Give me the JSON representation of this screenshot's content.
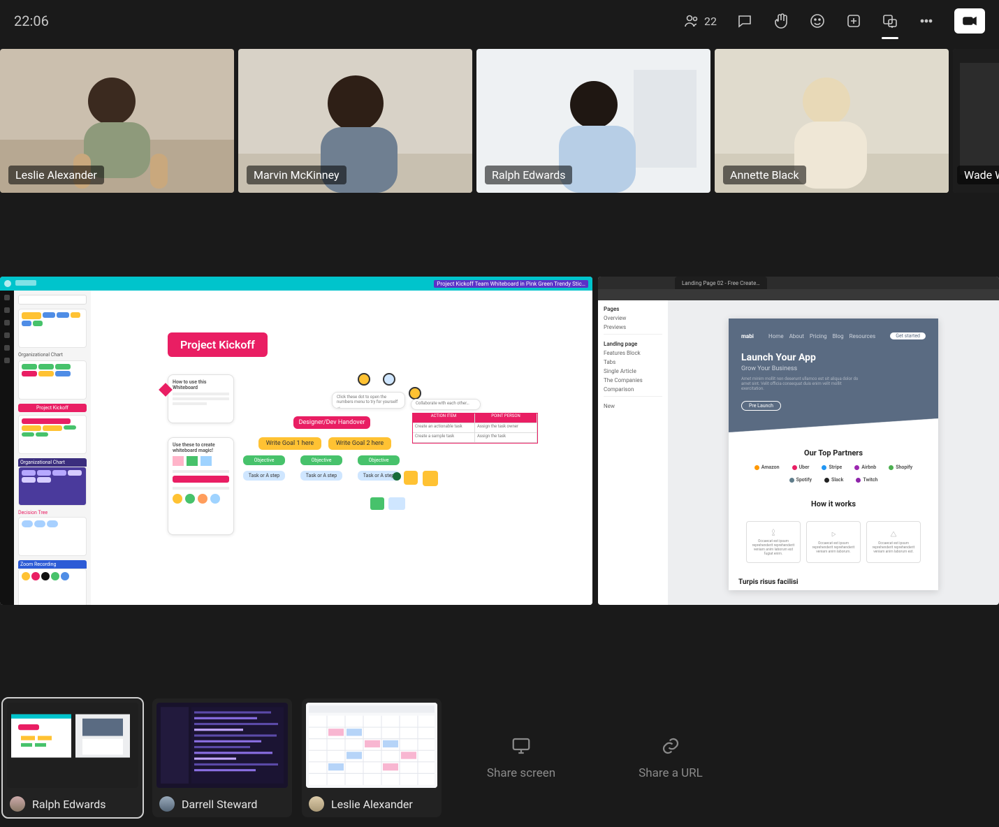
{
  "timer": "22:06",
  "top": {
    "participants_count": "22",
    "icons": {
      "people": "people-icon",
      "chat": "chat-icon",
      "hand": "raise-hand-icon",
      "emoji": "emoji-icon",
      "add": "add-app-icon",
      "layout": "view-layout-icon",
      "more": "more-icon",
      "camera": "camera-icon"
    }
  },
  "participants": [
    {
      "name": "Leslie Alexander"
    },
    {
      "name": "Marvin McKinney"
    },
    {
      "name": "Ralph Edwards"
    },
    {
      "name": "Annette Black"
    },
    {
      "name": "Wade Warren"
    }
  ],
  "canva": {
    "doc_title_right": "Project Kickoff Team Whiteboard in Pink Green Trendy Stic…",
    "project_kickoff_badge": "Project Kickoff",
    "note1_title": "How to use this Whiteboard",
    "note2_title": "Use these to create whiteboard magic!",
    "nodes": {
      "root": "Designer/Dev Handover",
      "row2a": "Write Goal 1 here",
      "row2b": "Write Goal 2 here",
      "obj": "Objective",
      "leaf": "Task or A step"
    },
    "table": {
      "h1": "ACTION ITEM",
      "h2": "POINT PERSON",
      "r1a": "Create an actionable task",
      "r1b": "Assign the task owner",
      "r2a": "Create a sample task",
      "r2b": "Assign the task"
    },
    "sidebar_labels": [
      "Organizational Chart",
      "Project Kickoff",
      "Organizational Chart",
      "Decision Tree",
      "Zoom Recording"
    ]
  },
  "figma": {
    "tab": "Landing Page 02 - Free Create…",
    "panel": [
      "Pages",
      "Overview",
      "Previews",
      "—",
      "Landing page",
      "Features Block",
      "Tabs",
      "Single Article",
      "The Companies",
      "Comparison",
      "—",
      "New"
    ],
    "lp": {
      "brand": "mabi",
      "nav": [
        "Home",
        "About",
        "Pricing",
        "Blog",
        "Resources"
      ],
      "nav_cta": "Get started",
      "h1": "Launch Your App",
      "sub": "Grow Your Business",
      "text": "Amet minim mollit non deserunt ullamco est sit aliqua dolor do amet sint. Velit officia consequat duis enim velit mollit exercitation.",
      "cta": "Pre Launch",
      "partners_title": "Our Top Partners",
      "partners": [
        "Amazon",
        "Uber",
        "Stripe",
        "Airbnb",
        "Shopify",
        "Spotify",
        "Slack",
        "Twitch"
      ],
      "how_title": "How it works",
      "how_cards": [
        "Occaecat est ipsum reprehenderit reprehenderit veniam anim laborum est fugiat enim.",
        "Occaecat est ipsum reprehenderit reprehenderit veniam anim laborum.",
        "Occaecat est ipsum reprehenderit reprehenderit veniam anim laborum est."
      ],
      "next_section": "Turpis risus facilisi"
    }
  },
  "tray": {
    "shares": [
      {
        "presenter": "Ralph Edwards",
        "selected": true,
        "kind": "whiteboard+lp"
      },
      {
        "presenter": "Darrell Steward",
        "selected": false,
        "kind": "code"
      },
      {
        "presenter": "Leslie Alexander",
        "selected": false,
        "kind": "calendar"
      }
    ],
    "share_screen": "Share screen",
    "share_url": "Share a URL"
  },
  "colors": {
    "pink": "#e91e63",
    "teal": "#00c4cc",
    "yellow": "#ffc233",
    "green": "#47c26b",
    "slate": "#5a6b82"
  }
}
